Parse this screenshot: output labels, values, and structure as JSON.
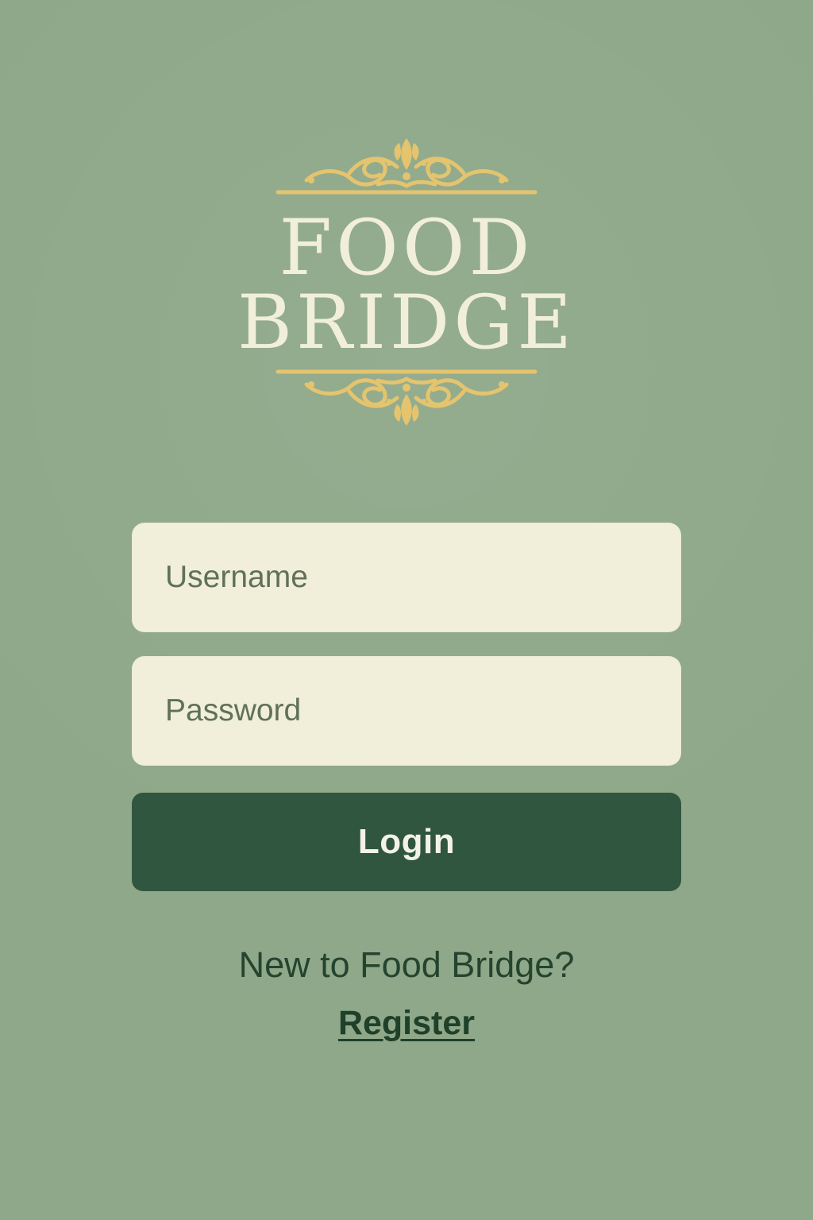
{
  "app": {
    "logo_line_1": "FOOD",
    "logo_line_2": "BRIDGE"
  },
  "login_form": {
    "username": {
      "placeholder": "Username",
      "value": ""
    },
    "password": {
      "placeholder": "Password",
      "value": ""
    },
    "login_label": "Login"
  },
  "register": {
    "prompt": "New to Food Bridge?",
    "link_label": "Register"
  },
  "icons": {
    "logo_ornament_top": "decorative-flourish-icon",
    "logo_ornament_bottom": "decorative-flourish-icon"
  },
  "colors": {
    "background": "#8fa889",
    "logo_text": "#f1efda",
    "ornament_gold": "#e4c46e",
    "input_background": "#f1efd9",
    "button_background": "#30563f",
    "button_text": "#f4f2e7",
    "link_text": "#1f4029"
  }
}
